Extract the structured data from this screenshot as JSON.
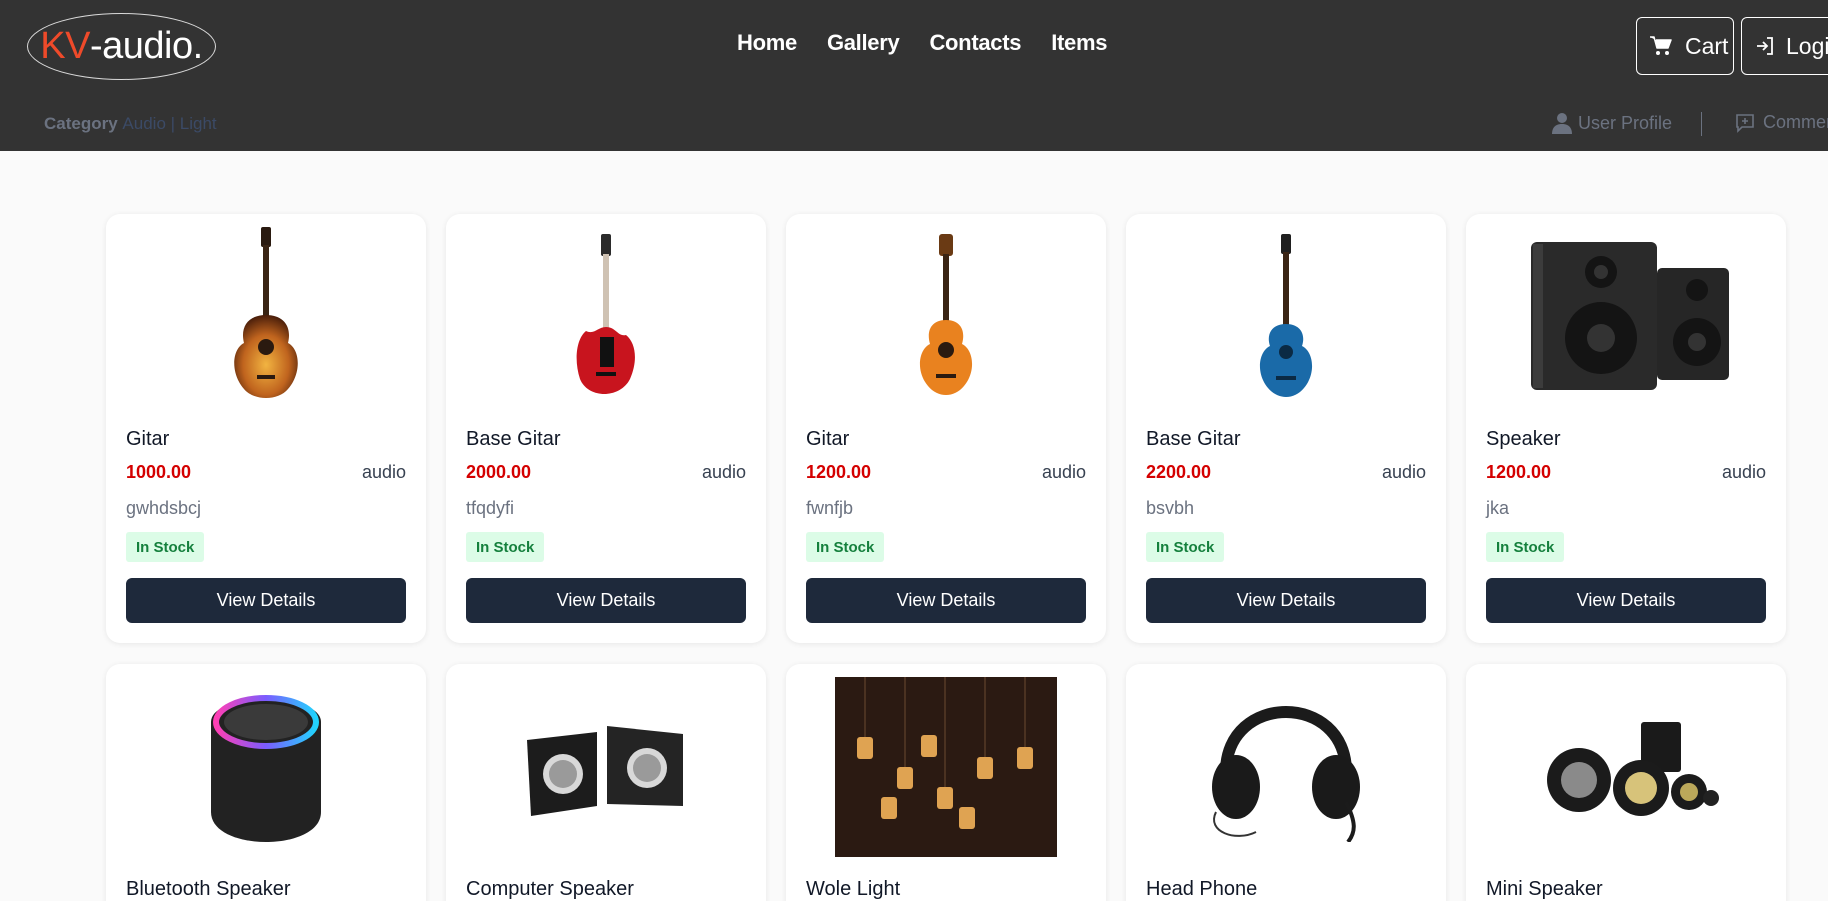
{
  "brand": {
    "prefix": "KV",
    "suffix": "-audio."
  },
  "nav": [
    "Home",
    "Gallery",
    "Contacts",
    "Items"
  ],
  "actions": {
    "cart": "Cart",
    "login": "Login"
  },
  "subbar": {
    "category_label": "Category",
    "category_links": "Audio | Light",
    "profile": "User Profile",
    "comments": "Comments"
  },
  "colors": {
    "header": "#333333",
    "accent": "#ef4a2a",
    "price": "#d40000",
    "button": "#1e293b",
    "stock_bg": "#dcfce7",
    "stock_text": "#15803d"
  },
  "products": [
    {
      "name": "Gitar",
      "price": "1000.00",
      "category": "audio",
      "desc": "gwhdsbcj",
      "stock": "In Stock",
      "button": "View Details",
      "icon": "acoustic-guitar-sunburst"
    },
    {
      "name": "Base Gitar",
      "price": "2000.00",
      "category": "audio",
      "desc": "tfqdyfi",
      "stock": "In Stock",
      "button": "View Details",
      "icon": "electric-guitar-red"
    },
    {
      "name": "Gitar",
      "price": "1200.00",
      "category": "audio",
      "desc": "fwnfjb",
      "stock": "In Stock",
      "button": "View Details",
      "icon": "classical-guitar-orange"
    },
    {
      "name": "Base Gitar",
      "price": "2200.00",
      "category": "audio",
      "desc": "bsvbh",
      "stock": "In Stock",
      "button": "View Details",
      "icon": "acoustic-guitar-blue"
    },
    {
      "name": "Speaker",
      "price": "1200.00",
      "category": "audio",
      "desc": "jka",
      "stock": "In Stock",
      "button": "View Details",
      "icon": "bookshelf-speakers"
    },
    {
      "name": "Bluetooth Speaker",
      "icon": "bluetooth-speaker"
    },
    {
      "name": "Computer Speaker",
      "icon": "computer-speakers"
    },
    {
      "name": "Wole Light",
      "icon": "jar-chandelier"
    },
    {
      "name": "Head Phone",
      "icon": "headphones"
    },
    {
      "name": "Mini Speaker",
      "icon": "car-speaker-set"
    }
  ]
}
